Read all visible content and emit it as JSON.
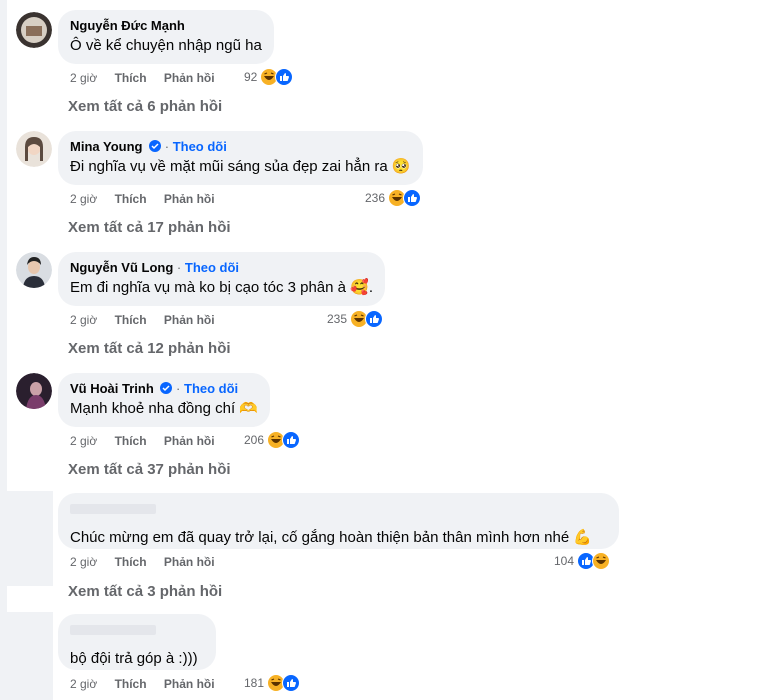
{
  "comments": [
    {
      "author": "Nguyễn Đức Mạnh",
      "text": "Ô về kể chuyện nhập ngũ ha",
      "time": "2 giờ",
      "like": "Thích",
      "reply": "Phản hồi",
      "reaction_count": "92",
      "view_replies": "Xem tất cả 6 phản hồi"
    },
    {
      "author": "Mina Young",
      "separator": "·",
      "follow": "Theo dõi",
      "text": "Đi nghĩa vụ về mặt mũi sáng sủa đẹp zai hẳn ra",
      "emoji": "🥺",
      "time": "2 giờ",
      "like": "Thích",
      "reply": "Phản hồi",
      "reaction_count": "236",
      "view_replies": "Xem tất cả 17 phản hồi"
    },
    {
      "author": "Nguyễn Vũ Long",
      "separator": "·",
      "follow": "Theo dõi",
      "text": "Em đi nghĩa vụ mà ko bị cạo tóc 3 phân à",
      "emoji": "🥰",
      "text_suffix": ".",
      "time": "2 giờ",
      "like": "Thích",
      "reply": "Phản hồi",
      "reaction_count": "235",
      "view_replies": "Xem tất cả 12 phản hồi"
    },
    {
      "author": "Vũ Hoài Trinh",
      "separator": "·",
      "follow": "Theo dõi",
      "text": "Mạnh khoẻ nha đồng chí",
      "emoji": "🫶",
      "time": "2 giờ",
      "like": "Thích",
      "reply": "Phản hồi",
      "reaction_count": "206",
      "view_replies": "Xem tất cả 37 phản hồi"
    },
    {
      "author": "",
      "text": "Chúc mừng em đã quay trở lại, cố gắng hoàn thiện bản thân mình hơn nhé",
      "emoji": "💪",
      "time": "2 giờ",
      "like": "Thích",
      "reply": "Phản hồi",
      "reaction_count": "104",
      "view_replies": "Xem tất cả 3 phản hồi"
    },
    {
      "author": "",
      "text": "bộ đội trả góp à :)))",
      "time": "2 giờ",
      "like": "Thích",
      "reply": "Phản hồi",
      "reaction_count": "181"
    }
  ],
  "icons": {
    "reaction_haha": "haha-icon",
    "reaction_like": "like-icon",
    "verified": "verified-badge-icon"
  },
  "colors": {
    "accent": "#0866ff",
    "bubble": "#f0f2f5",
    "meta": "#65676b",
    "haha": "#f7b125"
  }
}
